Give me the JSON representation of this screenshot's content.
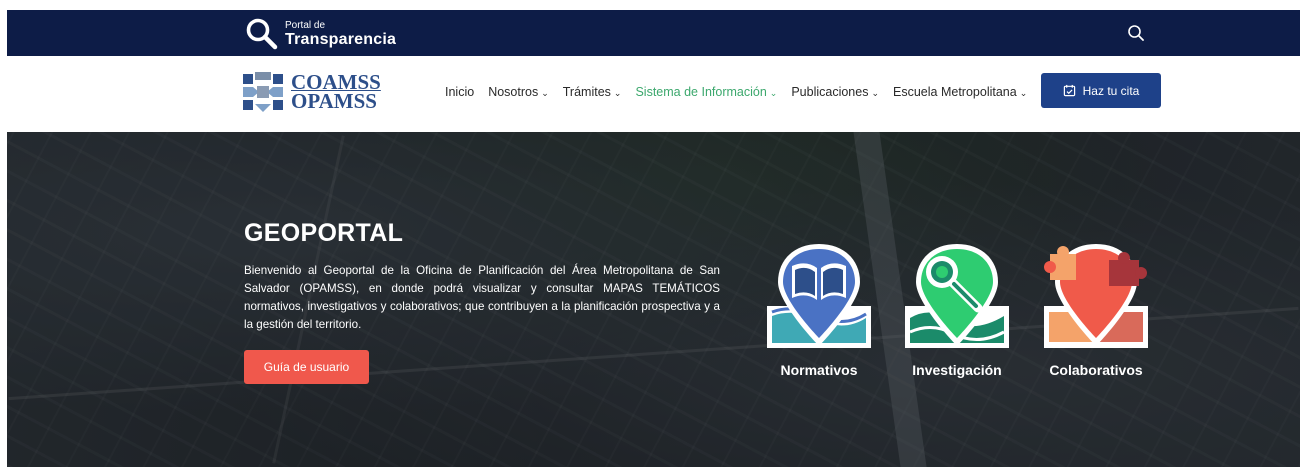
{
  "topbar": {
    "brand_small": "Portal de",
    "brand_big": "Transparencia",
    "icons": {
      "brand": "search-icon",
      "search": "search-icon"
    }
  },
  "navbar": {
    "logo": {
      "line1": "COAMSS",
      "line2": "OPAMSS"
    },
    "menu": [
      {
        "label": "Inicio",
        "has_dropdown": false
      },
      {
        "label": "Nosotros",
        "has_dropdown": true
      },
      {
        "label": "Trámites",
        "has_dropdown": true
      },
      {
        "label": "Sistema de Información",
        "has_dropdown": true,
        "active": true
      },
      {
        "label": "Publicaciones",
        "has_dropdown": true
      },
      {
        "label": "Escuela Metropolitana",
        "has_dropdown": true
      }
    ],
    "cta_label": "Haz tu cita",
    "cta_icon": "calendar-check-icon"
  },
  "hero": {
    "title": "GEOPORTAL",
    "description": "Bienvenido al Geoportal de la Oficina de Planificación del Área Metropolitana de San Salvador (OPAMSS), en donde podrá visualizar y consultar MAPAS TEMÁTICOS normativos, investigativos y colaborativos; que contribuyen a la planificación prospectiva y a la gestión del territorio.",
    "button_label": "Guía de usuario",
    "themes": [
      {
        "label": "Normativos",
        "icon": "book-map-icon"
      },
      {
        "label": "Investigación",
        "icon": "magnifier-map-icon"
      },
      {
        "label": "Colaborativos",
        "icon": "puzzle-map-icon"
      }
    ]
  },
  "colors": {
    "topbar": "#0d1c47",
    "brand_blue": "#1e4189",
    "active_nav": "#3ca86d",
    "hero_button": "#f0584c",
    "normativos": "#4a72c4",
    "investigacion": "#2ecc71",
    "colaborativos": "#f05a4a"
  }
}
